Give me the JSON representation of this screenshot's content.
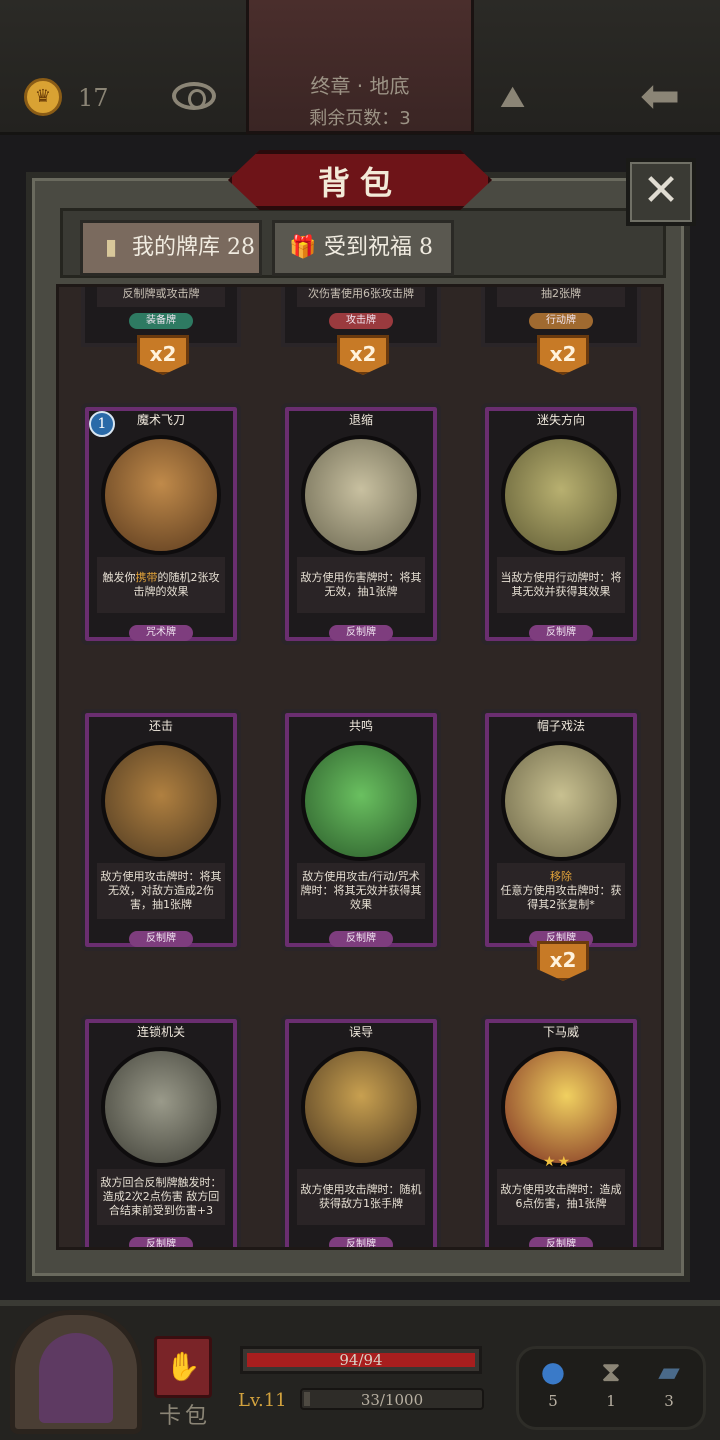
{
  "header": {
    "coins": "17",
    "chapter": "终章 · 地底",
    "pages_left": "剩余页数：3"
  },
  "panel": {
    "title": "背包",
    "close_label": "✕",
    "tabs": [
      {
        "label": "我的牌库",
        "count": "28"
      },
      {
        "label": "受到祝福",
        "count": "8"
      }
    ]
  },
  "top_row": [
    {
      "desc": "反制牌或攻击牌",
      "type": "装备牌",
      "badge": "x2"
    },
    {
      "desc": "次伤害使用6张攻击牌",
      "type": "攻击牌",
      "badge": "x2"
    },
    {
      "desc": "抽2张牌",
      "type": "行动牌",
      "badge": "x2"
    }
  ],
  "cards": [
    {
      "title": "魔术飞刀",
      "level": "1",
      "desc_pre": "触发你",
      "desc_hl": "携带",
      "desc_post": "的随机2张攻击牌的效果",
      "type": "咒术牌"
    },
    {
      "title": "退缩",
      "desc": "敌方使用伤害牌时：将其无效，抽1张牌",
      "type": "反制牌"
    },
    {
      "title": "迷失方向",
      "desc": "当敌方使用行动牌时：将其无效并获得其效果",
      "type": "反制牌"
    },
    {
      "title": "还击",
      "desc": "敌方使用攻击牌时：将其无效，对敌方造成2伤害，抽1张牌",
      "type": "反制牌"
    },
    {
      "title": "共鸣",
      "desc": "敌方使用攻击/行动/咒术牌时：将其无效并获得其效果",
      "type": "反制牌"
    },
    {
      "title": "帽子戏法",
      "desc_hl": "移除",
      "desc": "任意方使用攻击牌时：获得其2张复制*",
      "type": "反制牌",
      "badge": "x2"
    },
    {
      "title": "连锁机关",
      "desc": "敌方回合反制牌触发时：造成2次2点伤害 敌方回合结束前受到伤害+3",
      "type": "反制牌"
    },
    {
      "title": "误导",
      "desc": "敌方使用攻击牌时：随机获得敌方1张手牌",
      "type": "反制牌"
    },
    {
      "title": "下马威",
      "stars": "★★",
      "desc": "敌方使用攻击牌时：造成6点伤害，抽1张牌",
      "type": "反制牌"
    }
  ],
  "bottom": {
    "bag_label": "卡包",
    "hp": "94/94",
    "hp_fraction": 1.0,
    "level": "Lv.11",
    "xp": "33/1000",
    "xp_fraction": 0.033,
    "items": [
      {
        "icon": "potion-icon",
        "count": "5"
      },
      {
        "icon": "hourglass-icon",
        "count": "1"
      },
      {
        "icon": "cards-icon",
        "count": "3"
      }
    ]
  },
  "colors": {
    "counter_type": "#7e3d7e",
    "title_plate": "#6e1418",
    "count_badge": "#c77a26"
  }
}
